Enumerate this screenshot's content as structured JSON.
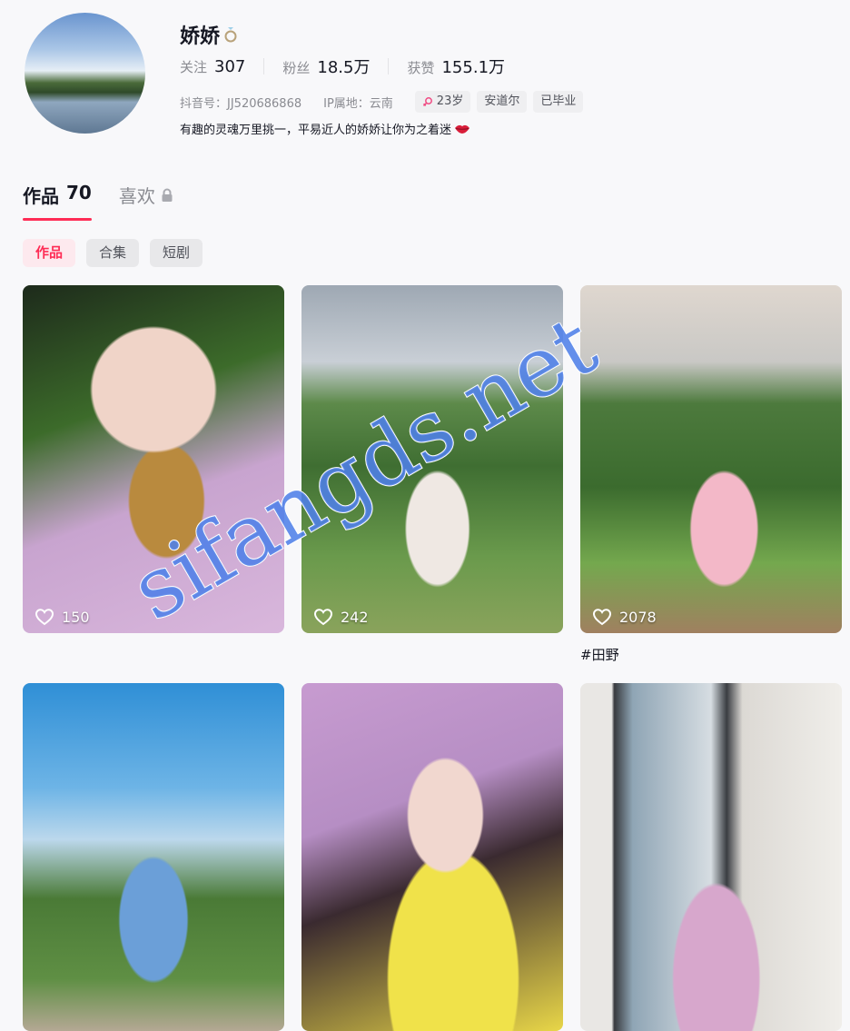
{
  "profile": {
    "name": "娇娇",
    "stats": {
      "following_label": "关注",
      "following_value": "307",
      "followers_label": "粉丝",
      "followers_value": "18.5万",
      "likes_label": "获赞",
      "likes_value": "155.1万"
    },
    "douyin_id": "抖音号：JJ520686868",
    "ip_location": "IP属地：云南",
    "tags": [
      "23岁",
      "安道尔",
      "已毕业"
    ],
    "bio": "有趣的灵魂万里挑一，平易近人的娇娇让你为之着迷"
  },
  "tabs": {
    "works_label": "作品",
    "works_count": "70",
    "likes_label": "喜欢"
  },
  "filters": [
    "作品",
    "合集",
    "短剧"
  ],
  "videos": [
    {
      "likes": "150"
    },
    {
      "likes": "242"
    },
    {
      "likes": "2078",
      "caption": "#田野"
    },
    {},
    {},
    {}
  ],
  "watermark": "sifangds.net",
  "colors": {
    "accent": "#fe2c55",
    "text": "#161823",
    "muted": "#8a8b91",
    "background": "#f8f8fa"
  },
  "icons": [
    "ring-icon",
    "female-icon",
    "lips-icon",
    "lock-icon",
    "heart-icon"
  ]
}
